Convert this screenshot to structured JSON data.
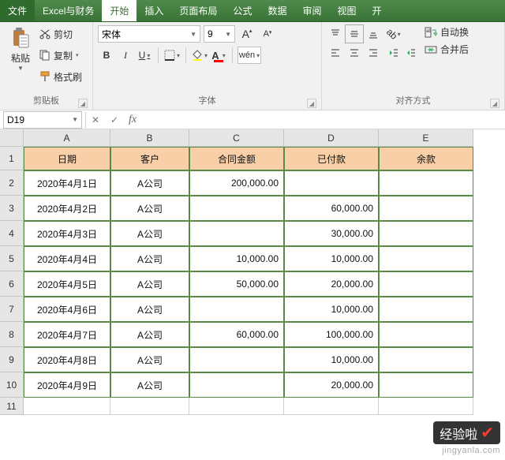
{
  "tabs": {
    "file": "文件",
    "addin": "Excel与财务",
    "home": "开始",
    "insert": "插入",
    "layout": "页面布局",
    "formula": "公式",
    "data": "数据",
    "review": "审阅",
    "view": "视图",
    "dev": "开"
  },
  "clipboard": {
    "paste": "粘贴",
    "cut": "剪切",
    "copy": "复制",
    "fmt": "格式刷",
    "label": "剪贴板"
  },
  "font": {
    "name": "宋体",
    "size": "9",
    "bold": "B",
    "italic": "I",
    "underline": "U",
    "pinyin": "wén",
    "label": "字体",
    "grow": "A",
    "shrink": "A"
  },
  "align": {
    "label": "对齐方式",
    "wrap": "自动换",
    "merge": "合并后"
  },
  "namebox": {
    "cell": "D19"
  },
  "columns": [
    "A",
    "B",
    "C",
    "D",
    "E"
  ],
  "widths": [
    110,
    100,
    120,
    120,
    120
  ],
  "rowh_head": 30,
  "rowh_data": 32,
  "rowh_plain": 22,
  "headers": [
    "日期",
    "客户",
    "合同金额",
    "已付款",
    "余款"
  ],
  "rows": [
    {
      "n": "1"
    },
    {
      "n": "2",
      "date": "2020年4月1日",
      "cust": "A公司",
      "amt": "200,000.00",
      "paid": "",
      "bal": ""
    },
    {
      "n": "3",
      "date": "2020年4月2日",
      "cust": "A公司",
      "amt": "",
      "paid": "60,000.00",
      "bal": ""
    },
    {
      "n": "4",
      "date": "2020年4月3日",
      "cust": "A公司",
      "amt": "",
      "paid": "30,000.00",
      "bal": ""
    },
    {
      "n": "5",
      "date": "2020年4月4日",
      "cust": "A公司",
      "amt": "10,000.00",
      "paid": "10,000.00",
      "bal": ""
    },
    {
      "n": "6",
      "date": "2020年4月5日",
      "cust": "A公司",
      "amt": "50,000.00",
      "paid": "20,000.00",
      "bal": ""
    },
    {
      "n": "7",
      "date": "2020年4月6日",
      "cust": "A公司",
      "amt": "",
      "paid": "10,000.00",
      "bal": ""
    },
    {
      "n": "8",
      "date": "2020年4月7日",
      "cust": "A公司",
      "amt": "60,000.00",
      "paid": "100,000.00",
      "bal": ""
    },
    {
      "n": "9",
      "date": "2020年4月8日",
      "cust": "A公司",
      "amt": "",
      "paid": "10,000.00",
      "bal": ""
    },
    {
      "n": "10",
      "date": "2020年4月9日",
      "cust": "A公司",
      "amt": "",
      "paid": "20,000.00",
      "bal": ""
    },
    {
      "n": "11"
    }
  ],
  "watermark": {
    "brand": "经验啦",
    "url": "jingyanla.com"
  }
}
